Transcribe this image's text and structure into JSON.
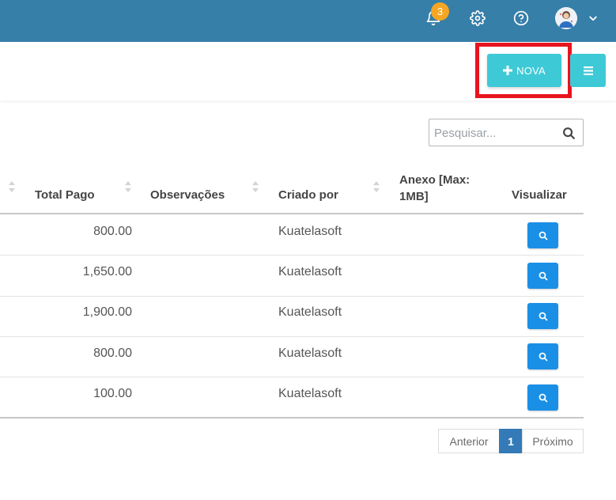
{
  "navbar": {
    "notification_count": "3",
    "icons": [
      "bell-icon",
      "gear-icon",
      "help-icon",
      "avatar",
      "chevron-down-icon"
    ],
    "color": "#367fa9"
  },
  "toolbar": {
    "new_label": "NOVA",
    "new_icon": "plus-icon",
    "menu_icon": "menu-icon",
    "button_color": "#3ec9d6",
    "highlight_color": "#e8141e"
  },
  "search": {
    "placeholder": "Pesquisar..."
  },
  "table": {
    "columns": [
      "Total Pago",
      "Observações",
      "Criado por",
      "Anexo [Max: 1MB]",
      "Visualizar"
    ],
    "rows": [
      {
        "total": "800.00",
        "obs": "",
        "criado": "Kuatelasoft",
        "anexo": ""
      },
      {
        "total": "1,650.00",
        "obs": "",
        "criado": "Kuatelasoft",
        "anexo": ""
      },
      {
        "total": "1,900.00",
        "obs": "",
        "criado": "Kuatelasoft",
        "anexo": ""
      },
      {
        "total": "800.00",
        "obs": "",
        "criado": "Kuatelasoft",
        "anexo": ""
      },
      {
        "total": "100.00",
        "obs": "",
        "criado": "Kuatelasoft",
        "anexo": ""
      }
    ],
    "view_button_color": "#1a8fe6"
  },
  "pagination": {
    "prev": "Anterior",
    "current": "1",
    "next": "Próximo"
  }
}
